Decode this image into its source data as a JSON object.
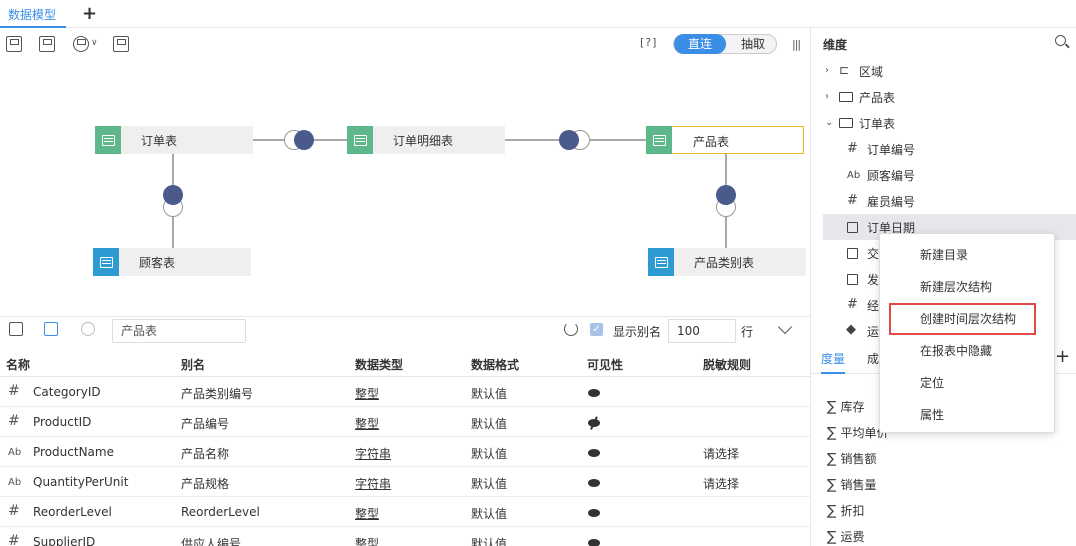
{
  "tabs": {
    "active_tab": "数据模型",
    "add_label": "+"
  },
  "toolbar": {
    "help_label": "[?]",
    "mode_direct": "直连",
    "mode_extract": "抽取",
    "more_label": "|||"
  },
  "diagram": {
    "nodes": {
      "orders": "订单表",
      "order_details": "订单明细表",
      "products": "产品表",
      "customers": "顾客表",
      "categories": "产品类别表"
    }
  },
  "grid_toolbar": {
    "search_value": "产品表",
    "show_alias_label": "显示别名",
    "show_alias_checked": true,
    "row_count": "100",
    "row_unit": "行"
  },
  "grid": {
    "headers": [
      "名称",
      "别名",
      "数据类型",
      "数据格式",
      "可见性",
      "脱敏规则"
    ],
    "rows": [
      {
        "type_icon": "#",
        "name": "CategoryID",
        "alias": "产品类别编号",
        "dtype": "整型",
        "format": "默认值",
        "visibility": "visible",
        "mask": ""
      },
      {
        "type_icon": "#",
        "name": "ProductID",
        "alias": "产品编号",
        "dtype": "整型",
        "format": "默认值",
        "visibility": "hidden",
        "mask": ""
      },
      {
        "type_icon": "Ab",
        "name": "ProductName",
        "alias": "产品名称",
        "dtype": "字符串",
        "format": "默认值",
        "visibility": "visible",
        "mask": "请选择"
      },
      {
        "type_icon": "Ab",
        "name": "QuantityPerUnit",
        "alias": "产品规格",
        "dtype": "字符串",
        "format": "默认值",
        "visibility": "visible",
        "mask": "请选择"
      },
      {
        "type_icon": "#",
        "name": "ReorderLevel",
        "alias": "ReorderLevel",
        "dtype": "整型",
        "format": "默认值",
        "visibility": "visible",
        "mask": ""
      },
      {
        "type_icon": "#",
        "name": "SupplierID",
        "alias": "供应人编号",
        "dtype": "整型",
        "format": "默认值",
        "visibility": "visible",
        "mask": ""
      }
    ]
  },
  "dimensions": {
    "title": "维度",
    "tree": [
      {
        "label": "区域",
        "icon": "hierarchy",
        "expanded": false
      },
      {
        "label": "产品表",
        "icon": "folder",
        "expanded": false
      },
      {
        "label": "订单表",
        "icon": "folder-open",
        "expanded": true
      },
      {
        "label": "订单编号",
        "icon": "#"
      },
      {
        "label": "顾客编号",
        "icon": "Ab"
      },
      {
        "label": "雇员编号",
        "icon": "#"
      },
      {
        "label": "订单日期",
        "icon": "calendar",
        "highlighted": true
      },
      {
        "label": "交",
        "icon": "calendar"
      },
      {
        "label": "发",
        "icon": "calendar"
      },
      {
        "label": "经",
        "icon": "#"
      },
      {
        "label": "运",
        "icon": "geo"
      }
    ]
  },
  "measures": {
    "tab_measure": "度量",
    "tab_member": "成",
    "add_label": "+",
    "items": [
      "库存",
      "平均单价",
      "销售额",
      "销售量",
      "折扣",
      "运费"
    ]
  },
  "context_menu": {
    "items": [
      "新建目录",
      "新建层次结构",
      "创建时间层次结构",
      "在报表中隐藏",
      "定位",
      "属性"
    ],
    "highlighted_index": 2
  },
  "colors": {
    "accent": "#3a8ee6",
    "node_green": "#5fb88a",
    "node_blue": "#2d9bd2",
    "dot": "#4a5a8a",
    "selected_border": "#e8b820",
    "menu_highlight": "#e04a48"
  }
}
